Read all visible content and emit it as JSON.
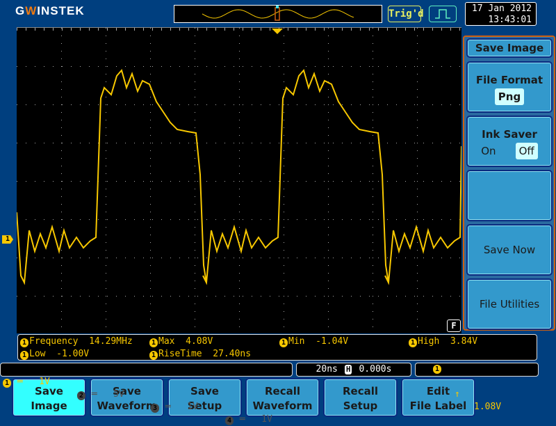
{
  "header": {
    "logo": "GWINSTEK",
    "trigger_status": "Trig'd",
    "date": "17 Jan 2012",
    "time": "13:43:01"
  },
  "colors": {
    "ch1": "#f8c800",
    "accent": "#3399cc",
    "active": "#33ffff"
  },
  "screen": {
    "channel_marker": "1",
    "filter_marker": "F"
  },
  "side_menu": {
    "title": "Save Image",
    "file_format_label": "File Format",
    "file_format_value": "Png",
    "ink_saver_label": "Ink Saver",
    "ink_on": "On",
    "ink_off": "Off",
    "save_now": "Save Now",
    "file_utilities": "File Utilities"
  },
  "measurements": [
    {
      "ch": "1",
      "label": "Frequency",
      "value": "14.29MHz"
    },
    {
      "ch": "1",
      "label": "Max",
      "value": "4.08V"
    },
    {
      "ch": "1",
      "label": "Min",
      "value": "-1.04V"
    },
    {
      "ch": "1",
      "label": "High",
      "value": "3.84V"
    },
    {
      "ch": "1",
      "label": "Low",
      "value": "-1.00V"
    },
    {
      "ch": "1",
      "label": "RiseTime",
      "value": "27.40ns"
    }
  ],
  "channels": [
    {
      "n": "1",
      "scale": "1V"
    },
    {
      "n": "2",
      "scale": "5V"
    },
    {
      "n": "3",
      "scale": "1V"
    },
    {
      "n": "4",
      "scale": "1V"
    }
  ],
  "timebase": {
    "scale": "20ns",
    "mode": "H",
    "position": "0.000s"
  },
  "trigger": {
    "source": "1",
    "slope": "rising",
    "level": "1.08V"
  },
  "bottom_menu": [
    {
      "l1": "Save",
      "l2": "Image"
    },
    {
      "l1": "Save",
      "l2": "Waveform"
    },
    {
      "l1": "Save",
      "l2": "Setup"
    },
    {
      "l1": "Recall",
      "l2": "Waveform"
    },
    {
      "l1": "Recall",
      "l2": "Setup"
    },
    {
      "l1": "Edit",
      "l2": "File Label"
    }
  ]
}
